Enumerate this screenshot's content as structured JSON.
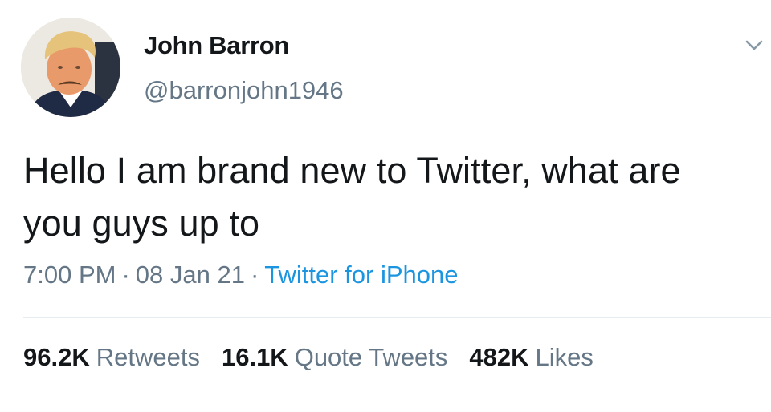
{
  "tweet": {
    "author": {
      "display_name": "John Barron",
      "handle": "@barronjohn1946",
      "avatar_icon": "profile-photo"
    },
    "more_icon": "chevron-down-icon",
    "text": "Hello I am brand new to Twitter, what are you guys up to",
    "time": "7:00 PM",
    "date": "08 Jan 21",
    "separator": "·",
    "source": "Twitter for iPhone",
    "stats": {
      "retweets": {
        "count": "96.2K",
        "label": "Retweets"
      },
      "quote_tweets": {
        "count": "16.1K",
        "label": "Quote Tweets"
      },
      "likes": {
        "count": "482K",
        "label": "Likes"
      }
    }
  },
  "colors": {
    "text": "#14171a",
    "secondary": "#657786",
    "link": "#1b95e0",
    "divider": "#e6ecf0"
  }
}
